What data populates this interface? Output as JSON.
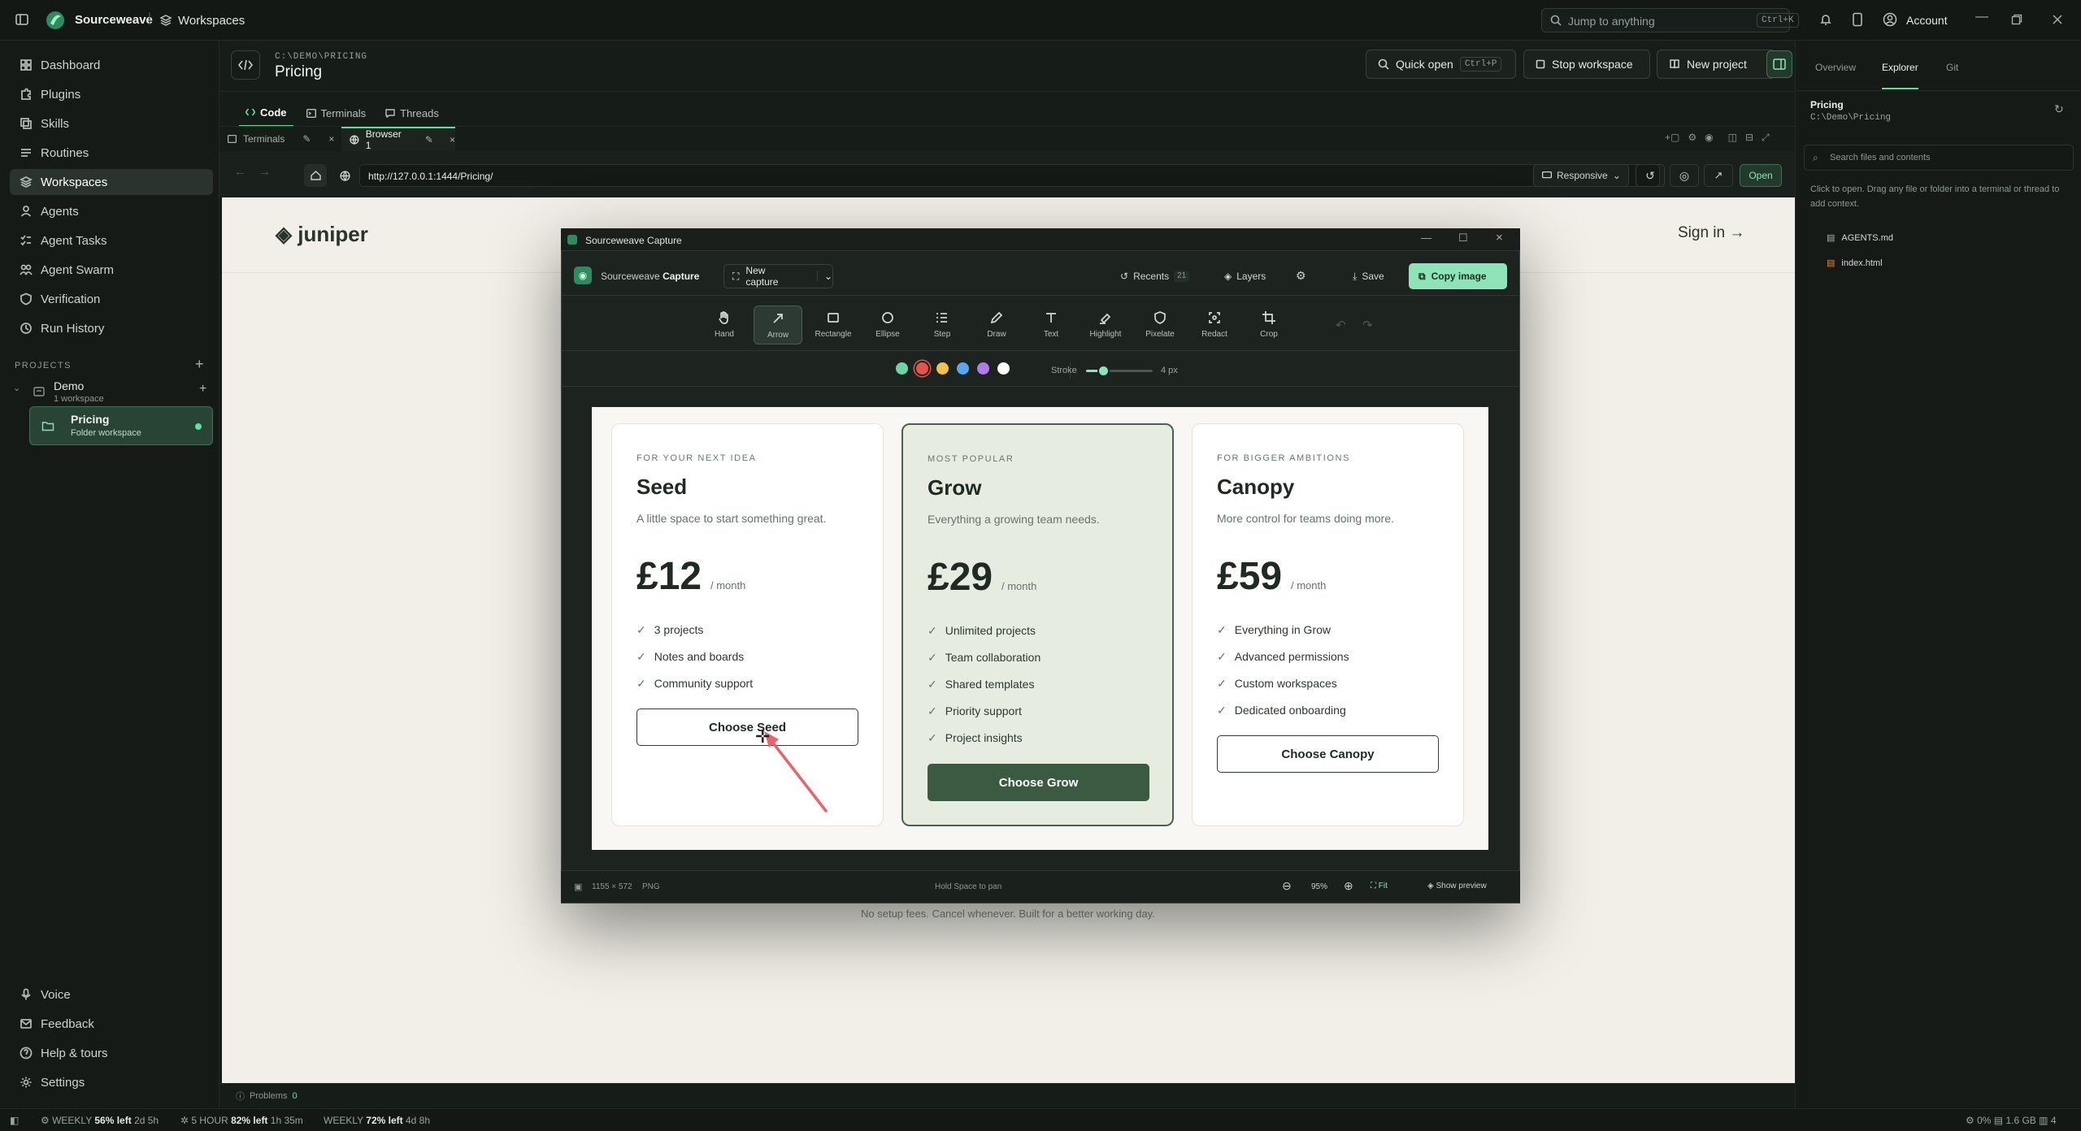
{
  "topbar": {
    "app_name": "Sourceweave",
    "section": "Workspaces",
    "search_placeholder": "Jump to anything",
    "search_kbd": "Ctrl+K",
    "account": "Account"
  },
  "sidebar": {
    "nav": [
      {
        "label": "Dashboard",
        "icon": "grid-icon"
      },
      {
        "label": "Plugins",
        "icon": "puzzle-icon"
      },
      {
        "label": "Skills",
        "icon": "layers-icon"
      },
      {
        "label": "Routines",
        "icon": "list-icon"
      },
      {
        "label": "Workspaces",
        "icon": "stack-icon"
      },
      {
        "label": "Agents",
        "icon": "user-icon"
      },
      {
        "label": "Agent Tasks",
        "icon": "tasks-icon"
      },
      {
        "label": "Agent Swarm",
        "icon": "swarm-icon"
      },
      {
        "label": "Verification",
        "icon": "shield-icon"
      },
      {
        "label": "Run History",
        "icon": "history-icon"
      }
    ],
    "projects_title": "PROJECTS",
    "project": {
      "name": "Demo",
      "sub": "1 workspace"
    },
    "workspace": {
      "name": "Pricing",
      "sub": "Folder workspace"
    },
    "bottom": [
      {
        "label": "Voice",
        "icon": "mic-icon"
      },
      {
        "label": "Feedback",
        "icon": "mail-icon"
      },
      {
        "label": "Help & tours",
        "icon": "help-icon"
      },
      {
        "label": "Settings",
        "icon": "gear-icon"
      }
    ]
  },
  "header": {
    "path": "C:\\DEMO\\PRICING",
    "title": "Pricing",
    "quick_open": "Quick open",
    "quick_open_kbd": "Ctrl+P",
    "stop_workspace": "Stop workspace",
    "new_project": "New project"
  },
  "tabs": [
    "Code",
    "Terminals",
    "Threads"
  ],
  "subtabs": [
    "Terminals",
    "Browser 1"
  ],
  "browser": {
    "url": "http://127.0.0.1:1444/Pricing/",
    "responsive": "Responsive",
    "open": "Open"
  },
  "site": {
    "logo": "juniper",
    "sign_in": "Sign in →",
    "footnote": "No setup fees. Cancel whenever. Built for a better working day."
  },
  "capture": {
    "window_title": "Sourceweave Capture",
    "brand": "Sourceweave",
    "brand_bold": "Capture",
    "new_capture": "New capture",
    "recents": "Recents",
    "recents_count": "21",
    "layers": "Layers",
    "save": "Save",
    "copy_image": "Copy image",
    "tools": [
      "Hand",
      "Arrow",
      "Rectangle",
      "Ellipse",
      "Step",
      "Draw",
      "Text",
      "Highlight",
      "Pixelate",
      "Redact",
      "Crop"
    ],
    "active_tool": "Arrow",
    "colors": [
      "#6fd3a6",
      "#e5534b",
      "#f2c14e",
      "#5aa6f0",
      "#b07ce8",
      "#ffffff"
    ],
    "selected_color": "#e5534b",
    "stroke_label": "Stroke",
    "stroke_value": "4 px",
    "stroke_level": 0.25,
    "footer_dims": "1155 × 572",
    "footer_format": "PNG",
    "footer_hint": "Hold Space to pan",
    "zoom": "95%",
    "fit": "Fit",
    "show_preview": "Show preview"
  },
  "plans": [
    {
      "eyebrow": "FOR YOUR NEXT IDEA",
      "name": "Seed",
      "desc": "A little space to start something great.",
      "price": "£12",
      "per": "/ month",
      "features": [
        "3 projects",
        "Notes and boards",
        "Community support"
      ],
      "cta": "Choose Seed"
    },
    {
      "eyebrow": "MOST POPULAR",
      "name": "Grow",
      "desc": "Everything a growing team needs.",
      "price": "£29",
      "per": "/ month",
      "features": [
        "Unlimited projects",
        "Team collaboration",
        "Shared templates",
        "Priority support",
        "Project insights"
      ],
      "cta": "Choose Grow"
    },
    {
      "eyebrow": "FOR BIGGER AMBITIONS",
      "name": "Canopy",
      "desc": "More control for teams doing more.",
      "price": "£59",
      "per": "/ month",
      "features": [
        "Everything in Grow",
        "Advanced permissions",
        "Custom workspaces",
        "Dedicated onboarding"
      ],
      "cta": "Choose Canopy"
    }
  ],
  "right_panel": {
    "tabs": [
      "Overview",
      "Explorer",
      "Git"
    ],
    "active_tab": "Explorer",
    "folder": "Pricing",
    "folder_path": "C:\\Demo\\Pricing",
    "search_placeholder": "Search files and contents",
    "hint": "Click to open. Drag any file or folder into a terminal or thread to add context.",
    "files": [
      "AGENTS.md",
      "index.html"
    ]
  },
  "problems": {
    "label": "Problems",
    "count": "0"
  },
  "status": {
    "weekly1_label": "WEEKLY",
    "weekly1_value": "56% left",
    "weekly1_time": "2d 5h",
    "hour_label": "5 HOUR",
    "hour_value": "82% left",
    "hour_time": "1h 35m",
    "weekly2_label": "WEEKLY",
    "weekly2_value": "72% left",
    "weekly2_time": "4d 8h",
    "cpu": "0%",
    "mem": "1.6 GB",
    "count": "4"
  },
  "colors": {
    "accent": "#8fe3b8",
    "brand_green": "#3b5a42"
  }
}
